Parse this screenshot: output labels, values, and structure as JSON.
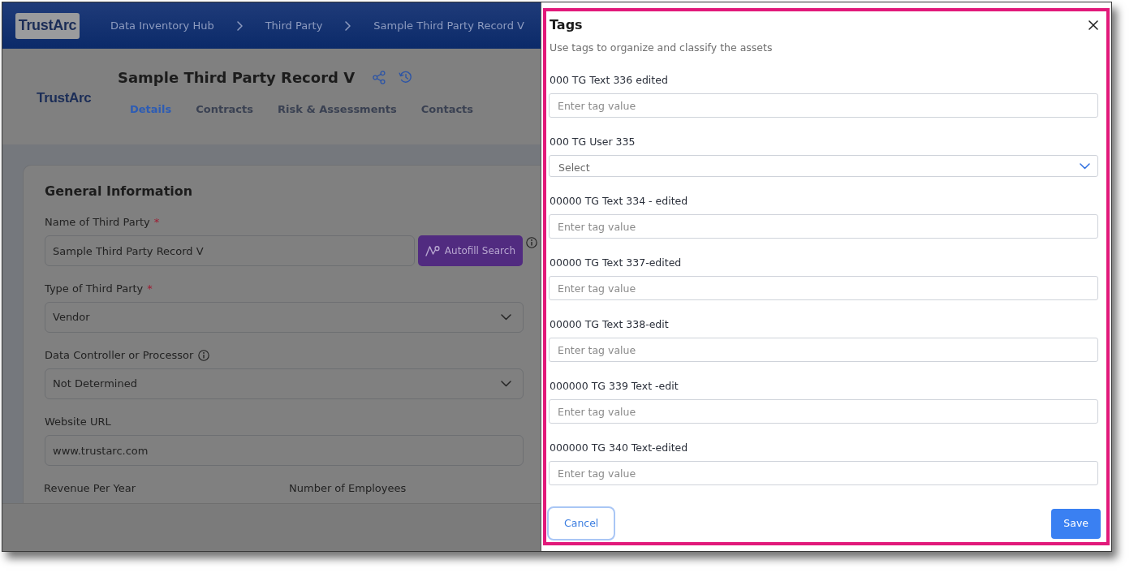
{
  "app": {
    "top_bar": {
      "logo": "TrustArc",
      "breadcrumbs": [
        "Data Inventory Hub",
        "Third Party",
        "Sample Third Party Record V"
      ]
    },
    "record": {
      "logo": "TrustArc",
      "title": "Sample Third Party Record V",
      "tabs": [
        {
          "label": "Details",
          "selected": true
        },
        {
          "label": "Contracts",
          "selected": false
        },
        {
          "label": "Risk & Assessments",
          "selected": false
        },
        {
          "label": "Contacts",
          "selected": false
        }
      ]
    },
    "general_information": {
      "title": "General Information",
      "fields": [
        {
          "kind": "text",
          "label": "Name of Third Party",
          "required_mark": "*",
          "info": true,
          "value": "Sample Third Party Record V",
          "action": "Autofill Search"
        },
        {
          "kind": "select",
          "label": "Type of Third Party",
          "required_mark": "*",
          "info": false,
          "value": "Vendor"
        },
        {
          "kind": "select",
          "label": "Data Controller or Processor",
          "info": true,
          "value": "Not Determined"
        },
        {
          "kind": "text",
          "label": "Website URL",
          "info": false,
          "value": "www.trustarc.com"
        }
      ],
      "next_row_labels": [
        "Revenue Per Year",
        "Number of Employees"
      ]
    }
  },
  "tags_panel": {
    "title": "Tags",
    "subtitle": "Use tags to organize and classify the assets",
    "fields": [
      {
        "kind": "text",
        "label": "000 TG Text 336 edited",
        "placeholder": "Enter tag value"
      },
      {
        "kind": "select",
        "label": "000 TG User 335",
        "placeholder": "Select"
      },
      {
        "kind": "text",
        "label": "00000 TG Text 334 - edited",
        "placeholder": "Enter tag value"
      },
      {
        "kind": "text",
        "label": "00000 TG Text 337-edited",
        "placeholder": "Enter tag value"
      },
      {
        "kind": "text",
        "label": "00000 TG Text 338-edit",
        "placeholder": "Enter tag value"
      },
      {
        "kind": "text",
        "label": "000000 TG 339 Text -edit",
        "placeholder": "Enter tag value"
      },
      {
        "kind": "text",
        "label": "000000 TG 340 Text-edited",
        "placeholder": "Enter tag value"
      }
    ],
    "buttons": [
      {
        "kind": "secondary",
        "label": "Cancel",
        "focused": true
      },
      {
        "kind": "primary",
        "label": "Save",
        "focused": false
      }
    ]
  }
}
